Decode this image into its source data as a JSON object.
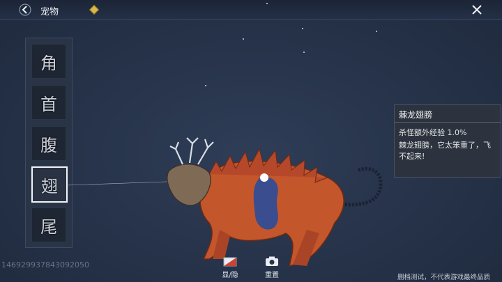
{
  "header": {
    "title": "宠物"
  },
  "parts": [
    {
      "label": "角",
      "active": false
    },
    {
      "label": "首",
      "active": false
    },
    {
      "label": "腹",
      "active": false
    },
    {
      "label": "翅",
      "active": true
    },
    {
      "label": "尾",
      "active": false
    }
  ],
  "info": {
    "title": "棘龙翅膀",
    "bonus": "杀怪额外经验 1.0%",
    "description": "棘龙翅膀，它太笨重了，飞不起来!"
  },
  "id_text": "146929937843092050",
  "toolbar": {
    "toggle_label": "显/隐",
    "reset_label": "重置"
  },
  "footer_note": "删档测试，不代表游戏最终品质",
  "colors": {
    "background": "#27344b",
    "accent": "#d9b94a",
    "creature_body": "#c4562c",
    "creature_stripe": "#2b4d9a"
  }
}
